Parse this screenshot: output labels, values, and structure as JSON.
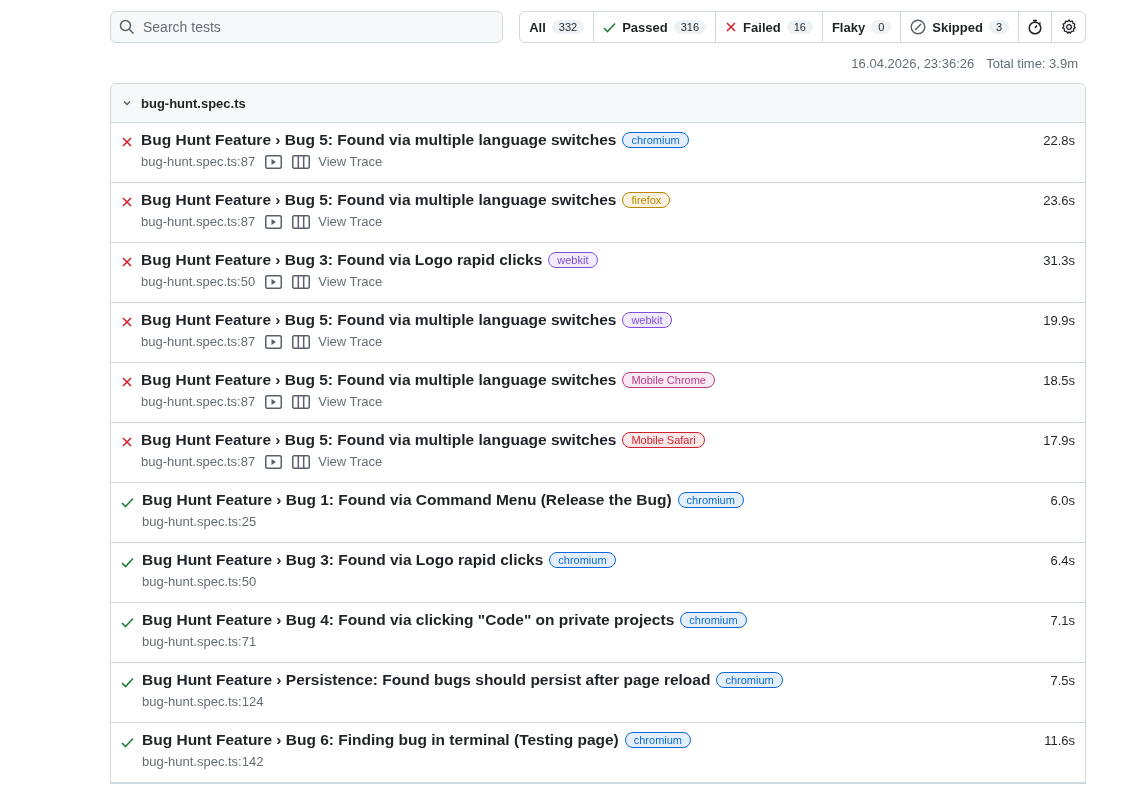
{
  "search": {
    "placeholder": "Search tests"
  },
  "filters": [
    {
      "kind": "plain",
      "label": "All",
      "count": "332",
      "selected": false
    },
    {
      "kind": "passed",
      "label": "Passed",
      "count": "316",
      "selected": false
    },
    {
      "kind": "failed",
      "label": "Failed",
      "count": "16",
      "selected": false
    },
    {
      "kind": "plain",
      "label": "Flaky",
      "count": "0",
      "selected": false
    },
    {
      "kind": "skipped",
      "label": "Skipped",
      "count": "3",
      "selected": false
    }
  ],
  "meta": {
    "date": "16.04.2026, 23:36:26",
    "total_time": "Total time: 3.9m"
  },
  "file": {
    "name": "bug-hunt.spec.ts",
    "expanded": true,
    "tests": [
      {
        "kind": "failed",
        "title": "Bug Hunt Feature › Bug 5: Found via multiple language switches",
        "project": "chromium",
        "color": "#0969da",
        "location": "bug-hunt.spec.ts:87",
        "trace": "View Trace",
        "duration": "22.8s"
      },
      {
        "kind": "failed",
        "title": "Bug Hunt Feature › Bug 5: Found via multiple language switches",
        "project": "firefox",
        "color": "#bf8700",
        "location": "bug-hunt.spec.ts:87",
        "trace": "View Trace",
        "duration": "23.6s"
      },
      {
        "kind": "failed",
        "title": "Bug Hunt Feature › Bug 3: Found via Logo rapid clicks",
        "project": "webkit",
        "color": "#8250df",
        "location": "bug-hunt.spec.ts:50",
        "trace": "View Trace",
        "duration": "31.3s"
      },
      {
        "kind": "failed",
        "title": "Bug Hunt Feature › Bug 5: Found via multiple language switches",
        "project": "webkit",
        "color": "#8250df",
        "location": "bug-hunt.spec.ts:87",
        "trace": "View Trace",
        "duration": "19.9s"
      },
      {
        "kind": "failed",
        "title": "Bug Hunt Feature › Bug 5: Found via multiple language switches",
        "project": "Mobile Chrome",
        "color": "#bf3989",
        "location": "bug-hunt.spec.ts:87",
        "trace": "View Trace",
        "duration": "18.5s"
      },
      {
        "kind": "failed",
        "title": "Bug Hunt Feature › Bug 5: Found via multiple language switches",
        "project": "Mobile Safari",
        "color": "#cf222e",
        "location": "bug-hunt.spec.ts:87",
        "trace": "View Trace",
        "duration": "17.9s"
      },
      {
        "kind": "passed",
        "title": "Bug Hunt Feature › Bug 1: Found via Command Menu (Release the Bug)",
        "project": "chromium",
        "color": "#0969da",
        "location": "bug-hunt.spec.ts:25",
        "duration": "6.0s"
      },
      {
        "kind": "passed",
        "title": "Bug Hunt Feature › Bug 3: Found via Logo rapid clicks",
        "project": "chromium",
        "color": "#0969da",
        "location": "bug-hunt.spec.ts:50",
        "duration": "6.4s"
      },
      {
        "kind": "passed",
        "title": "Bug Hunt Feature › Bug 4: Found via clicking \"Code\" on private projects",
        "project": "chromium",
        "color": "#0969da",
        "location": "bug-hunt.spec.ts:71",
        "duration": "7.1s"
      },
      {
        "kind": "passed",
        "title": "Bug Hunt Feature › Persistence: Found bugs should persist after page reload",
        "project": "chromium",
        "color": "#0969da",
        "location": "bug-hunt.spec.ts:124",
        "duration": "7.5s"
      },
      {
        "kind": "passed",
        "title": "Bug Hunt Feature › Bug 6: Finding bug in terminal (Testing page)",
        "project": "chromium",
        "color": "#0969da",
        "location": "bug-hunt.spec.ts:142",
        "duration": "11.6s"
      }
    ]
  }
}
